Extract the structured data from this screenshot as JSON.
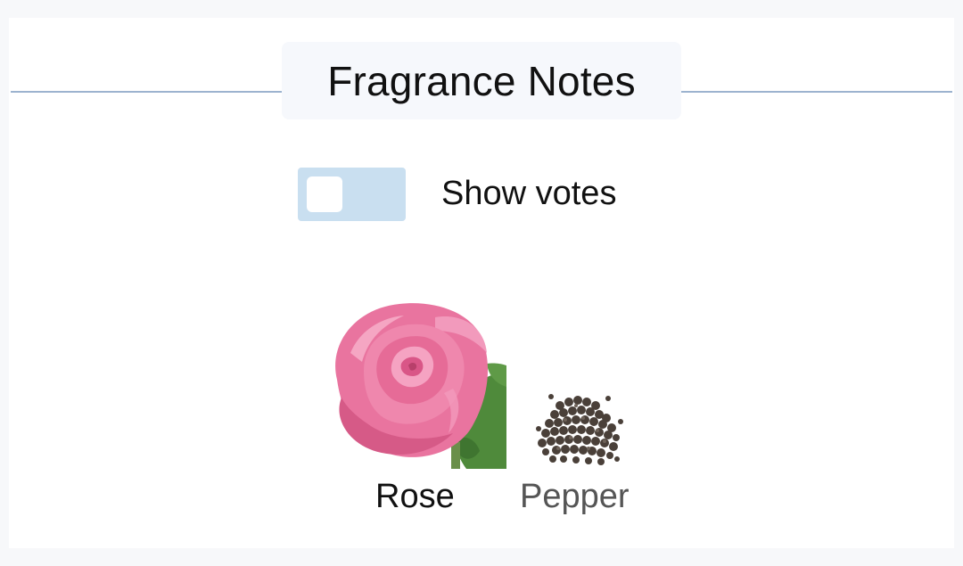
{
  "section": {
    "title": "Fragrance Notes"
  },
  "toggle": {
    "label": "Show votes",
    "checked": false,
    "track_color": "#c9dff0"
  },
  "notes": [
    {
      "name": "Rose",
      "icon": "rose-flower-image",
      "label_color": "#111111"
    },
    {
      "name": "Pepper",
      "icon": "black-peppercorns-image",
      "label_color": "#555555"
    }
  ],
  "colors": {
    "divider": "#9cb3cf",
    "rose": "#e9749f",
    "leaf": "#4f8a3b",
    "pepper": "#4a4039"
  }
}
